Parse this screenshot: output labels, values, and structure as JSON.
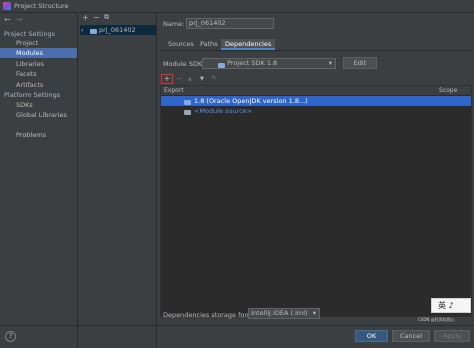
{
  "window": {
    "title": "Project Structure"
  },
  "left_nav": {
    "back_icon": "arrow-left-icon",
    "forward_icon": "arrow-right-icon",
    "sections": [
      {
        "header": "Project Settings",
        "items": [
          "Project",
          "Modules",
          "Libraries",
          "Facets",
          "Artifacts"
        ]
      },
      {
        "header": "Platform Settings",
        "items": [
          "SDKs",
          "Global Libraries"
        ]
      }
    ],
    "problems": "Problems",
    "selected": "Modules"
  },
  "tree": {
    "toolbar": {
      "add": "+",
      "remove": "−",
      "copy": "⧉"
    },
    "module": "prj_061402"
  },
  "module_panel": {
    "name_label": "Name:",
    "name_value": "prj_061402",
    "tabs": [
      "Sources",
      "Paths",
      "Dependencies"
    ],
    "active_tab": "Dependencies",
    "sdk_label": "Module SDK:",
    "sdk_value": "Project SDK 1.8",
    "edit_label": "Edit",
    "toolbar": {
      "add": "+",
      "remove": "−",
      "up": "▲",
      "down": "▼",
      "edit": "✎"
    },
    "table": {
      "col_export": "Export",
      "col_scope": "Scope",
      "rows": [
        "1.8 (Oracle OpenJDK version 1.8...)",
        "<Module source>"
      ]
    },
    "storage_label": "Dependencies storage format:",
    "storage_value": "IntelliJ IDEA (.iml)"
  },
  "footer": {
    "help": "?",
    "ok": "OK",
    "cancel": "Cancel",
    "apply": "Apply"
  },
  "ime": {
    "text": "英 ♪"
  },
  "watermark": "CSDN @狂风吹我心"
}
